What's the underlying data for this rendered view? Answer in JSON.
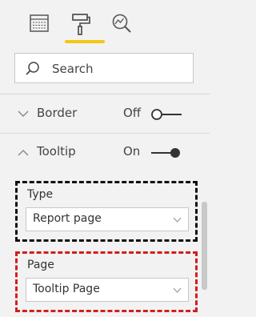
{
  "toolbar": {
    "tools": [
      {
        "icon": "fields-icon"
      },
      {
        "icon": "format-paint-roller-icon",
        "active": true
      },
      {
        "icon": "analytics-magnifier-icon"
      }
    ],
    "accent_color": "#f2c811"
  },
  "search": {
    "placeholder": "Search",
    "value": ""
  },
  "sections": {
    "border": {
      "label": "Border",
      "state_label": "Off",
      "expanded": false
    },
    "tooltip": {
      "label": "Tooltip",
      "state_label": "On",
      "expanded": true
    }
  },
  "tooltip_fields": {
    "type": {
      "label": "Type",
      "value": "Report page"
    },
    "page": {
      "label": "Page",
      "value": "Tooltip Page"
    }
  },
  "highlight_colors": {
    "type_box": "#111111",
    "page_box": "#d11f1f"
  }
}
